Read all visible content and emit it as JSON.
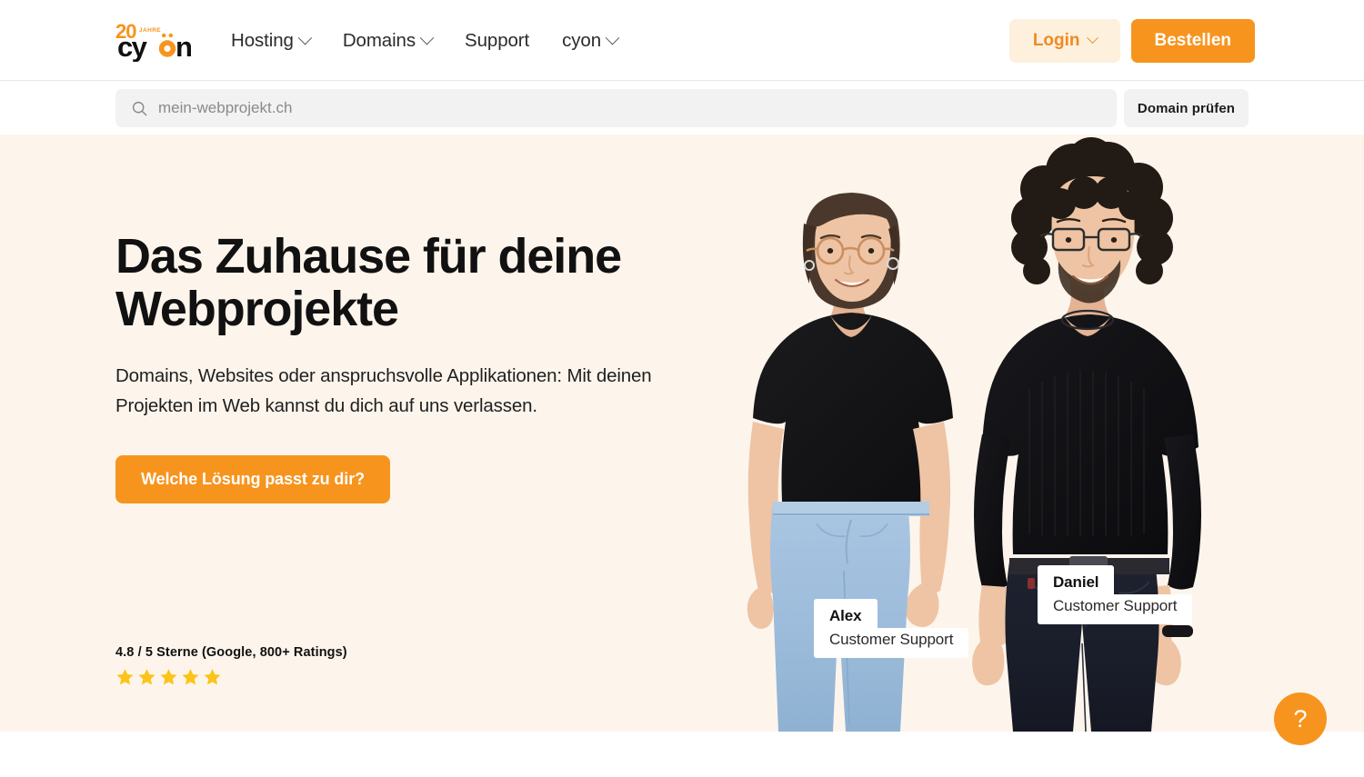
{
  "brand": {
    "logo_anniversary": "20",
    "logo_anniversary_label": "JAHRE",
    "logo_name": "cyon",
    "accent_orange": "#f7941e",
    "accent_light": "#fdf0dd",
    "hero_bg": "#fdf5ec",
    "star_gold": "#fcc419"
  },
  "header": {
    "nav": [
      {
        "label": "Hosting",
        "has_chevron": true,
        "icon": "chevron-down-icon"
      },
      {
        "label": "Domains",
        "has_chevron": true,
        "icon": "chevron-down-icon"
      },
      {
        "label": "Support",
        "has_chevron": false,
        "icon": ""
      },
      {
        "label": "cyon",
        "has_chevron": true,
        "icon": "chevron-down-icon"
      }
    ],
    "login_label": "Login",
    "order_label": "Bestellen"
  },
  "search": {
    "icon": "search-icon",
    "placeholder": "mein-webprojekt.ch",
    "value": "",
    "check_button_label": "Domain prüfen"
  },
  "hero": {
    "title": "Das Zuhause für deine Webprojekte",
    "subtitle": "Domains, Websites oder anspruchsvolle Applikationen: Mit deinen Projekten im Web kannst du dich auf uns verlassen.",
    "cta_label": "Welche Lösung passt zu dir?",
    "rating_text": "4.8 / 5 Sterne (Google, 800+ Ratings)",
    "star_count": 5,
    "people": [
      {
        "name": "Alex",
        "role": "Customer Support"
      },
      {
        "name": "Daniel",
        "role": "Customer Support"
      }
    ]
  },
  "help": {
    "icon": "question-mark-icon",
    "label": "?"
  }
}
